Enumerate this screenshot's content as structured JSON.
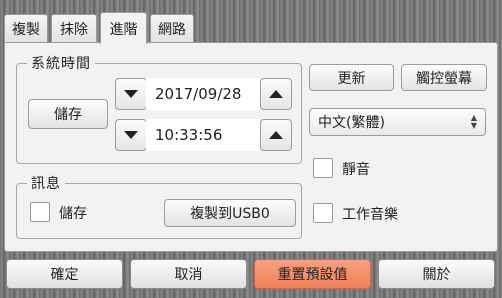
{
  "tabs": [
    {
      "label": "複製"
    },
    {
      "label": "抹除"
    },
    {
      "label": "進階",
      "active": true
    },
    {
      "label": "網路"
    }
  ],
  "system_time": {
    "group_label": "系統時間",
    "save_label": "儲存",
    "date_value": "2017/09/28",
    "time_value": "10:33:56"
  },
  "right_buttons": {
    "update_label": "更新",
    "touch_label": "觸控螢幕"
  },
  "language": {
    "selected": "中文(繁體)"
  },
  "toggles": {
    "mute_label": "靜音",
    "music_label": "工作音樂"
  },
  "message": {
    "group_label": "訊息",
    "save_label": "儲存",
    "copy_usb_label": "複製到USB0"
  },
  "bottom": {
    "ok_label": "確定",
    "cancel_label": "取消",
    "reset_label": "重置預設值",
    "about_label": "關於"
  },
  "colors": {
    "accent": "#f08a64",
    "panel": "#f2f2f2"
  }
}
